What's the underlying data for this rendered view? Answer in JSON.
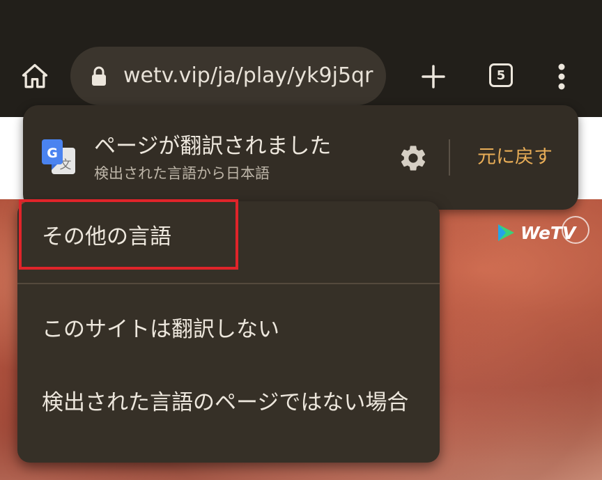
{
  "toolbar": {
    "home_icon": "home-icon",
    "url": "wetv.vip/ja/play/yk9j5qr",
    "tab_count": "5",
    "new_tab_icon": "plus-icon",
    "menu_icon": "more-vert-icon"
  },
  "page": {
    "logo_text": "WeTV"
  },
  "translate_bar": {
    "title": "ページが翻訳されました",
    "subtitle": "検出された言語から日本語",
    "revert_label": "元に戻す",
    "settings_icon": "gear-icon"
  },
  "menu": {
    "items": [
      {
        "label": "その他の言語"
      },
      {
        "label": "このサイトは翻訳しない"
      },
      {
        "label": "検出された言語のページではない場合"
      }
    ]
  },
  "colors": {
    "accent": "#e8ad57",
    "highlight": "#e0242a",
    "toolbar_bg": "#221f1a",
    "panel_bg": "#332d25"
  }
}
